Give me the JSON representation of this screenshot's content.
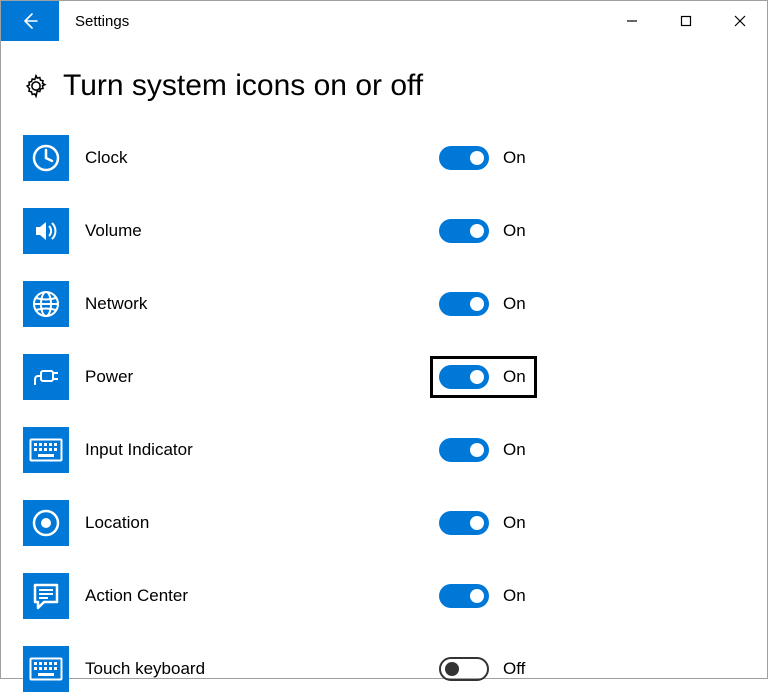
{
  "window": {
    "title": "Settings"
  },
  "page": {
    "heading": "Turn system icons on or off"
  },
  "labels": {
    "on": "On",
    "off": "Off"
  },
  "items": [
    {
      "id": "clock",
      "label": "Clock",
      "icon": "clock-icon",
      "on": true,
      "highlighted": false
    },
    {
      "id": "volume",
      "label": "Volume",
      "icon": "volume-icon",
      "on": true,
      "highlighted": false
    },
    {
      "id": "network",
      "label": "Network",
      "icon": "globe-icon",
      "on": true,
      "highlighted": false
    },
    {
      "id": "power",
      "label": "Power",
      "icon": "power-plug-icon",
      "on": true,
      "highlighted": true
    },
    {
      "id": "input-indicator",
      "label": "Input Indicator",
      "icon": "keyboard-icon",
      "on": true,
      "highlighted": false
    },
    {
      "id": "location",
      "label": "Location",
      "icon": "location-icon",
      "on": true,
      "highlighted": false
    },
    {
      "id": "action-center",
      "label": "Action Center",
      "icon": "action-center-icon",
      "on": true,
      "highlighted": false
    },
    {
      "id": "touch-keyboard",
      "label": "Touch keyboard",
      "icon": "keyboard-icon",
      "on": false,
      "highlighted": false
    }
  ],
  "colors": {
    "accent": "#0078d7"
  }
}
